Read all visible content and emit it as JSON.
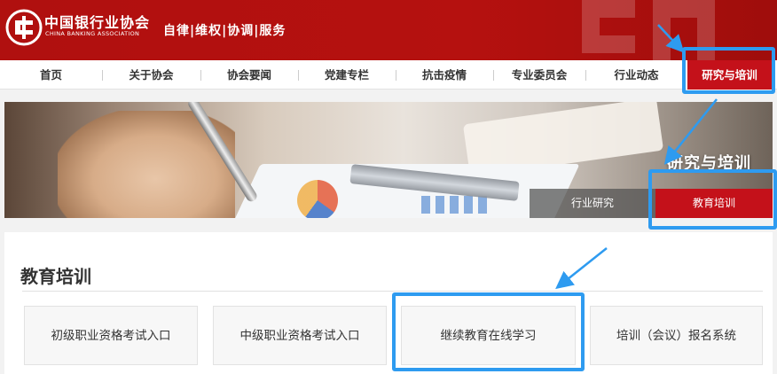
{
  "header": {
    "org_name": "中国银行业协会",
    "org_name_en": "CHINA BANKING ASSOCIATION",
    "slogan": "自律|维权|协调|服务",
    "brand_color": "#b5110f"
  },
  "nav": {
    "items": [
      {
        "label": "首页"
      },
      {
        "label": "关于协会"
      },
      {
        "label": "协会要闻"
      },
      {
        "label": "党建专栏"
      },
      {
        "label": "抗击疫情"
      },
      {
        "label": "专业委员会"
      },
      {
        "label": "行业动态"
      },
      {
        "label": "研究与培训",
        "active": true
      }
    ]
  },
  "banner": {
    "title": "研究与培训",
    "tabs": [
      {
        "label": "行业研究"
      },
      {
        "label": "教育培训",
        "active": true
      }
    ]
  },
  "content": {
    "section_title": "教育培训",
    "cards": [
      {
        "label": "初级职业资格考试入口"
      },
      {
        "label": "中级职业资格考试入口"
      },
      {
        "label": "继续教育在线学习"
      },
      {
        "label": "培训（会议）报名系统"
      }
    ]
  },
  "annotation": {
    "highlight_color": "#2e9bf0",
    "accent_color": "#c4111a"
  }
}
